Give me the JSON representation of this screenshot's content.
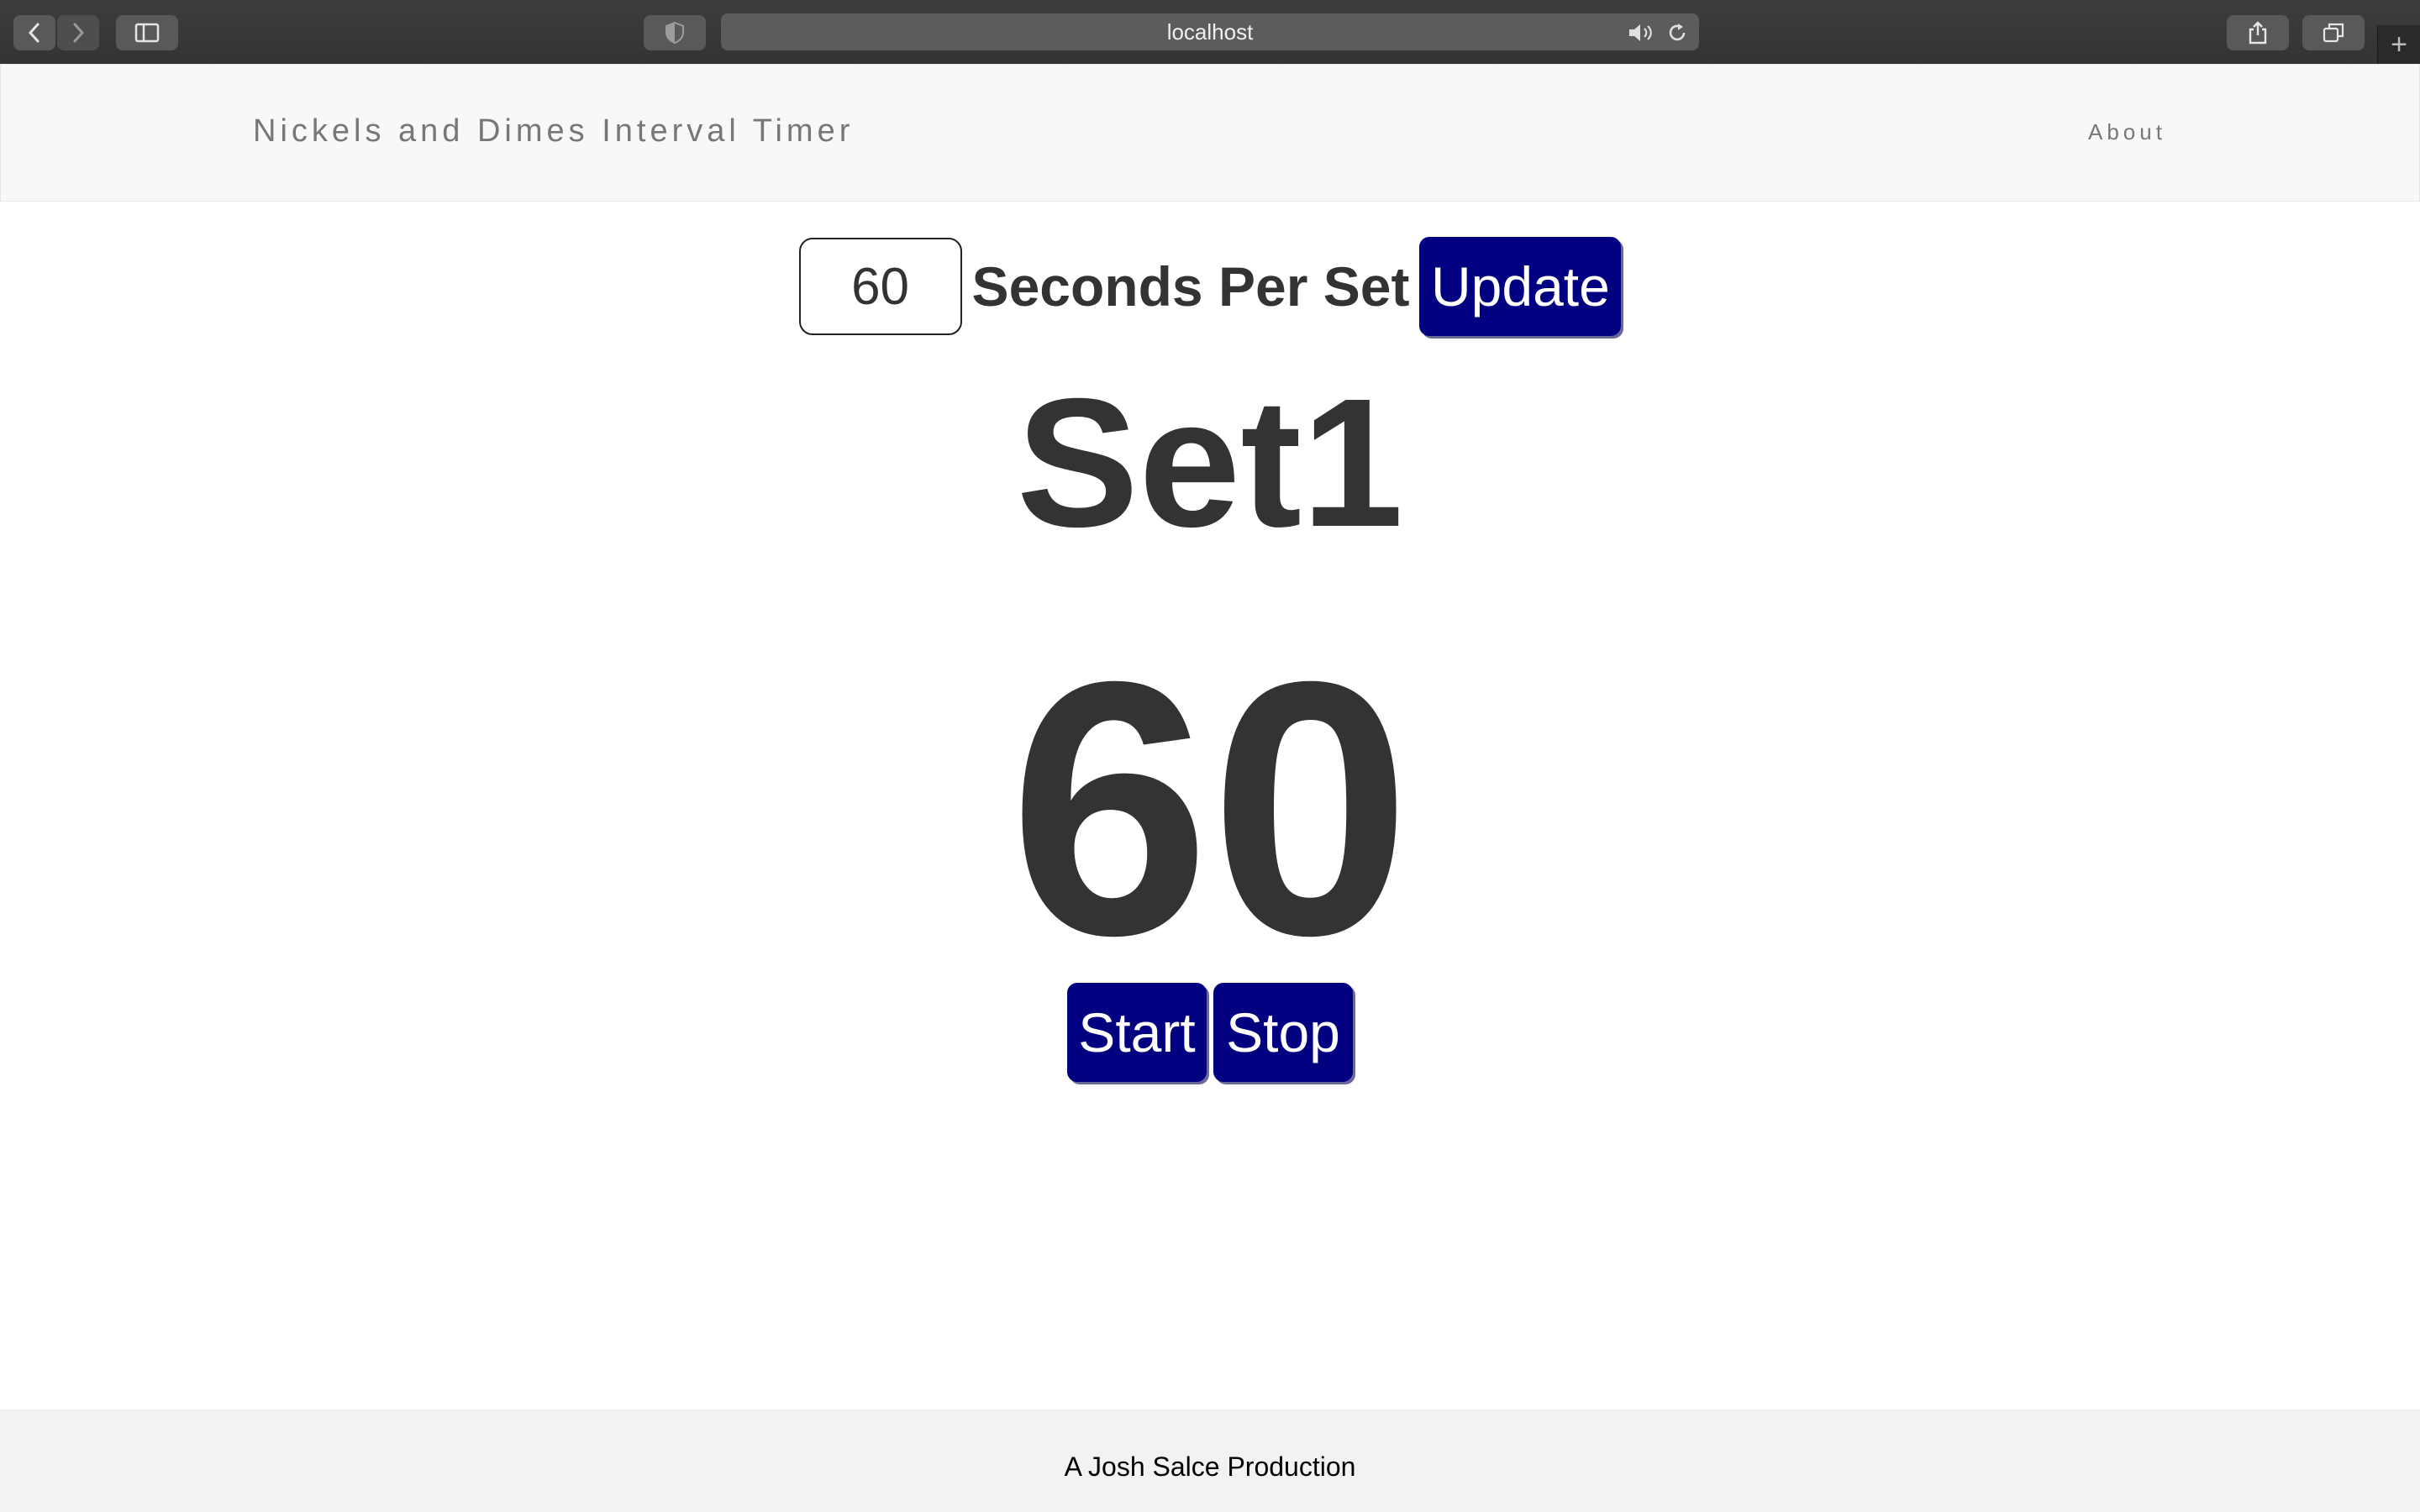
{
  "browser": {
    "url": "localhost",
    "icons": {
      "back": "chevron-left-icon",
      "forward": "chevron-right-icon",
      "sidebar": "sidebar-icon",
      "shield": "shield-icon",
      "audio": "speaker-icon",
      "reload": "reload-icon",
      "share": "share-icon",
      "tabs": "tab-overview-icon",
      "new_tab": "plus-icon"
    },
    "new_tab_glyph": "+"
  },
  "navbar": {
    "brand": "Nickels and Dimes Interval Timer",
    "links": [
      {
        "label": "About"
      }
    ]
  },
  "settings": {
    "seconds_value": "60",
    "seconds_label": "Seconds Per Set",
    "update_label": "Update"
  },
  "timer": {
    "set_label": "Set1",
    "countdown": "60"
  },
  "controls": {
    "start_label": "Start",
    "stop_label": "Stop"
  },
  "footer": {
    "text": "A Josh Salce Production"
  },
  "colors": {
    "button_bg": "#000080",
    "button_text": "#ffffff",
    "text_dark": "#333333",
    "nav_text": "#777777",
    "navbar_bg": "#f8f8f8",
    "footer_bg": "#f2f2f2",
    "chrome_bg": "#3a3a3a"
  }
}
